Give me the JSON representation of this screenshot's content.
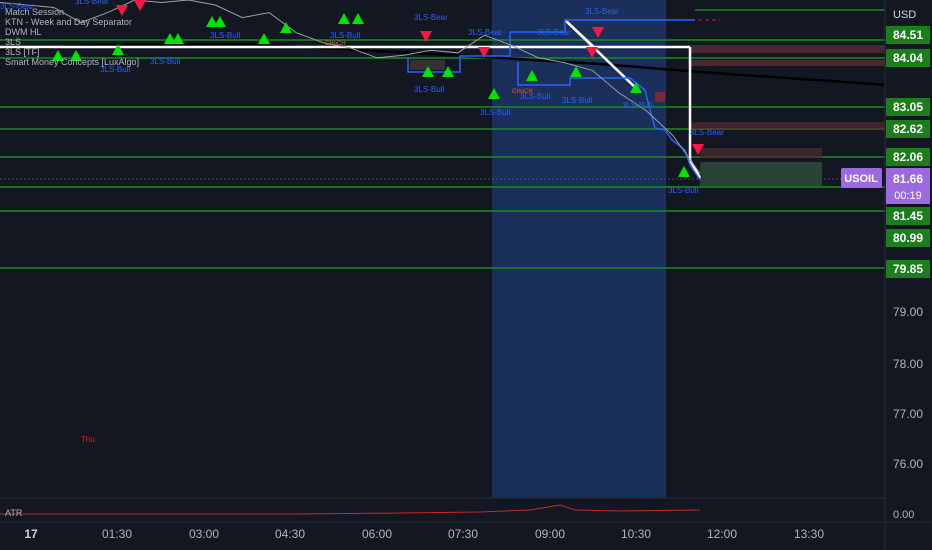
{
  "chart_data": {
    "type": "line",
    "symbol": "USOIL",
    "currency_label": "USD",
    "current_price": "81.66",
    "countdown": "00:19",
    "y_ticks": [
      "79.00",
      "78.00",
      "77.00",
      "76.00"
    ],
    "ylim": [
      75.5,
      85.2
    ],
    "x_ticks": [
      "17",
      "01:30",
      "03:00",
      "04:30",
      "06:00",
      "07:30",
      "09:00",
      "10:30",
      "12:00",
      "13:30"
    ],
    "level_labels": [
      "84.51",
      "84.04",
      "83.05",
      "82.62",
      "82.06",
      "81.45",
      "80.99",
      "79.85"
    ],
    "indicator_legend": [
      "Match Session",
      "KTN - Week and Day Separator",
      "DWM HL",
      "3LS",
      "3LS [TF]",
      "Smart Money Concepts [LuxAlgo]"
    ],
    "atr_label": "ATR",
    "atr_value": "0.00",
    "day_label": "Thu",
    "pattern_labels": {
      "bull": "3LS-Bull",
      "bear": "3LS-Bear",
      "choch": "CHoCH"
    },
    "price_series": [
      {
        "x": 0.0,
        "y": 85.15
      },
      {
        "x": 1.0,
        "y": 85.05
      },
      {
        "x": 1.5,
        "y": 84.75
      },
      {
        "x": 2.0,
        "y": 84.95
      },
      {
        "x": 2.5,
        "y": 85.2
      },
      {
        "x": 3.0,
        "y": 85.15
      },
      {
        "x": 3.5,
        "y": 85.2
      },
      {
        "x": 4.0,
        "y": 85.1
      },
      {
        "x": 4.5,
        "y": 84.85
      },
      {
        "x": 5.0,
        "y": 84.95
      },
      {
        "x": 5.5,
        "y": 84.55
      },
      {
        "x": 6.0,
        "y": 84.35
      },
      {
        "x": 6.5,
        "y": 84.25
      },
      {
        "x": 7.0,
        "y": 84.05
      },
      {
        "x": 7.5,
        "y": 84.1
      },
      {
        "x": 8.0,
        "y": 84.2
      },
      {
        "x": 8.5,
        "y": 84.15
      },
      {
        "x": 9.0,
        "y": 84.5
      },
      {
        "x": 9.5,
        "y": 84.3
      },
      {
        "x": 10.0,
        "y": 84.05
      },
      {
        "x": 10.5,
        "y": 83.95
      },
      {
        "x": 11.0,
        "y": 83.8
      },
      {
        "x": 11.5,
        "y": 83.35
      },
      {
        "x": 12.0,
        "y": 83.0
      },
      {
        "x": 12.5,
        "y": 82.5
      },
      {
        "x": 13.0,
        "y": 81.75
      }
    ]
  }
}
